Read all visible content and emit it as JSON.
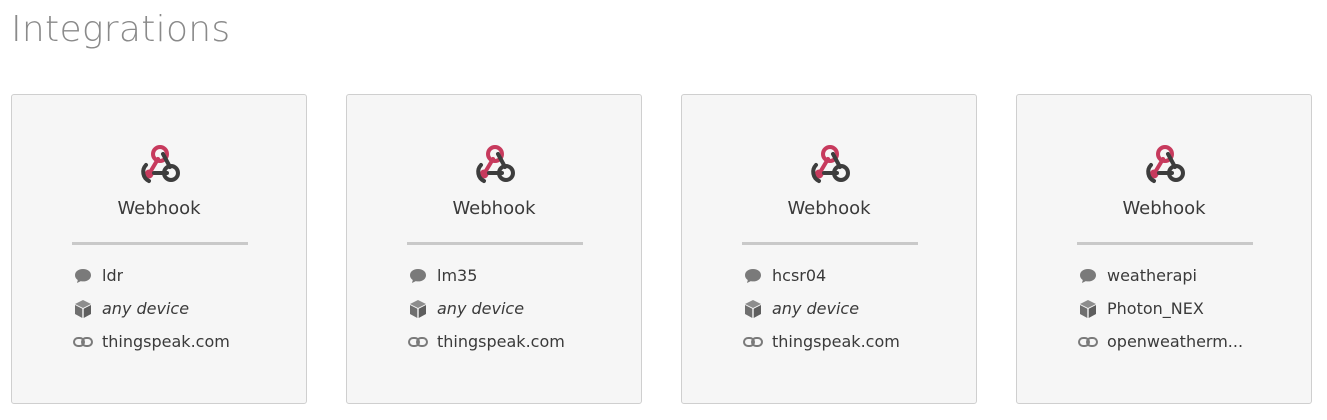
{
  "page": {
    "title": "Integrations"
  },
  "colors": {
    "webhook_red": "#c73a5d",
    "webhook_dark": "#3d3d3d",
    "icon_gray": "#7a7a7a",
    "card_bg": "#f6f6f6",
    "card_border": "#cfcfcf",
    "divider": "#c9c9c9",
    "title_gray": "#8a8a8a"
  },
  "icons": {
    "type_logo": "webhook-icon",
    "event": "speech-bubble-icon",
    "device": "cube-icon",
    "url": "link-icon"
  },
  "integrations": [
    {
      "type": "Webhook",
      "event": "ldr",
      "device": "any device",
      "device_any": true,
      "url": "thingspeak.com"
    },
    {
      "type": "Webhook",
      "event": "lm35",
      "device": "any device",
      "device_any": true,
      "url": "thingspeak.com"
    },
    {
      "type": "Webhook",
      "event": "hcsr04",
      "device": "any device",
      "device_any": true,
      "url": "thingspeak.com"
    },
    {
      "type": "Webhook",
      "event": "weatherapi",
      "device": "Photon_NEX",
      "device_any": false,
      "url": "openweatherm..."
    }
  ]
}
